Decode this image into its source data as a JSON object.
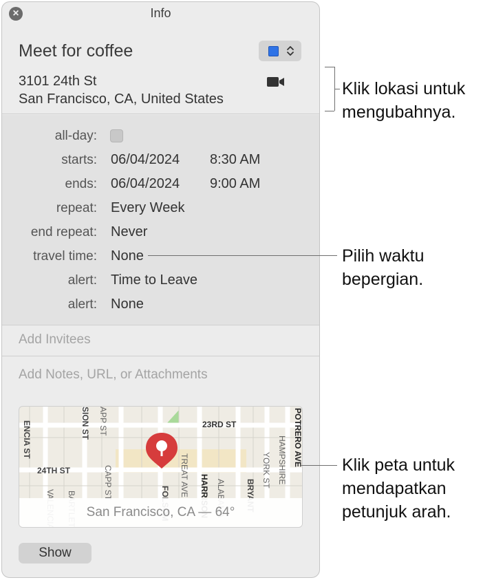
{
  "window": {
    "title": "Info"
  },
  "event": {
    "title": "Meet for coffee",
    "color": "#2f73e6",
    "location_line1": "3101 24th St",
    "location_line2": "San Francisco, CA, United States"
  },
  "details": {
    "allday_label": "all-day:",
    "allday_checked": false,
    "starts_label": "starts:",
    "starts_date": "06/04/2024",
    "starts_time": "8:30 AM",
    "ends_label": "ends:",
    "ends_date": "06/04/2024",
    "ends_time": "9:00 AM",
    "repeat_label": "repeat:",
    "repeat_value": "Every Week",
    "end_repeat_label": "end repeat:",
    "end_repeat_value": "Never",
    "travel_label": "travel time:",
    "travel_value": "None",
    "alert1_label": "alert:",
    "alert1_value": "Time to Leave",
    "alert2_label": "alert:",
    "alert2_value": "None"
  },
  "invitees_placeholder": "Add Invitees",
  "notes_placeholder": "Add Notes, URL, or Attachments",
  "map": {
    "caption": "San Francisco, CA — 64°",
    "streets": {
      "s1": "ENCIA ST",
      "s2": "SION ST",
      "s3": "APP ST",
      "s4": "23RD ST",
      "s5": "24TH ST",
      "s6": "CAPP ST",
      "s7": "TREAT AVE",
      "s8": "HARRISON",
      "s9": "FOLSOM",
      "s10": "ALABAMA",
      "s11": "BRYANT",
      "s12": "YORK ST",
      "s13": "HAMPSHIRE",
      "s14": "POTRERO AVE",
      "s15": "VALENCIA",
      "s16": "BARTLETT"
    }
  },
  "show_button": "Show",
  "callouts": {
    "location_1": "Klik lokasi untuk",
    "location_2": "mengubahnya.",
    "travel_1": "Pilih waktu",
    "travel_2": "bepergian.",
    "map_1": "Klik peta untuk",
    "map_2": "mendapatkan",
    "map_3": "petunjuk arah."
  }
}
